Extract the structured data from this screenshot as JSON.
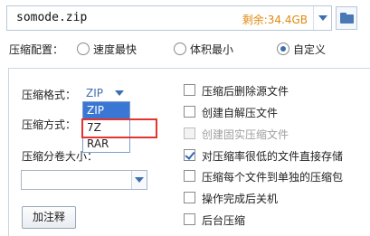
{
  "path_bar": {
    "filename": "somode.zip",
    "free_space": "剩余:34.4GB"
  },
  "compression_config": {
    "label": "压缩配置：",
    "options": [
      {
        "label": "速度最快",
        "selected": false
      },
      {
        "label": "体积最小",
        "selected": false
      },
      {
        "label": "自定义",
        "selected": true
      }
    ]
  },
  "left_panel": {
    "format_label": "压缩格式：",
    "format_value": "ZIP",
    "format_options": [
      "ZIP",
      "7Z",
      "RAR"
    ],
    "method_label": "压缩方式：",
    "split_label": "压缩分卷大小：",
    "split_value": "",
    "comment_button": "加注释"
  },
  "right_panel": {
    "checkboxes": [
      {
        "label": "压缩后删除源文件",
        "checked": false,
        "disabled": false
      },
      {
        "label": "创建自解压文件",
        "checked": false,
        "disabled": false
      },
      {
        "label": "创建固实压缩文件",
        "checked": false,
        "disabled": true
      },
      {
        "label": "对压缩率很低的文件直接存储",
        "checked": true,
        "disabled": false
      },
      {
        "label": "压缩每个文件到单独的压缩包",
        "checked": false,
        "disabled": false
      },
      {
        "label": "操作完成后关机",
        "checked": false,
        "disabled": false
      },
      {
        "label": "后台压缩",
        "checked": false,
        "disabled": false
      }
    ]
  },
  "colors": {
    "accent": "#3d6fb0",
    "free_space": "#e08a10",
    "selection": "#3a77d4",
    "highlight_box": "#e3342f"
  },
  "icons": {
    "path_dropdown": "chevron-down-icon",
    "folder_button": "folder-icon",
    "format_dropdown": "chevron-down-icon",
    "split_dropdown": "chevron-down-icon"
  }
}
